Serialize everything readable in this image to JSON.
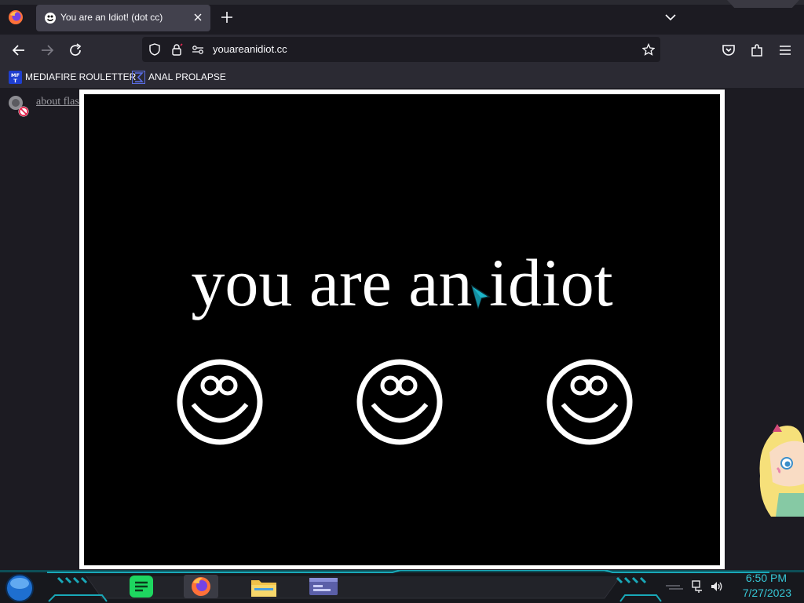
{
  "browser": {
    "tab": {
      "title": "You are an Idiot! (dot cc)"
    },
    "url": "youareanidiot.cc"
  },
  "bookmarks": [
    {
      "label": "MEDIAFIRE ROULETTER",
      "icon": "mediafire-icon",
      "badge": "MF T"
    },
    {
      "label": "ANAL PROLAPSE",
      "icon": "sigma-icon"
    }
  ],
  "page": {
    "about_link": "about flash",
    "headline": "you are an idiot",
    "smiley_count": 3
  },
  "taskbar": {
    "time": "6:50 PM",
    "date": "7/27/2023",
    "apps": [
      "spotify-icon",
      "firefox-icon",
      "file-explorer-icon",
      "window-icon"
    ]
  },
  "colors": {
    "tab_active": "#42414d",
    "toolbar": "#2b2a33",
    "clock": "#37c7d6",
    "accent_teal": "#19a8b8"
  }
}
